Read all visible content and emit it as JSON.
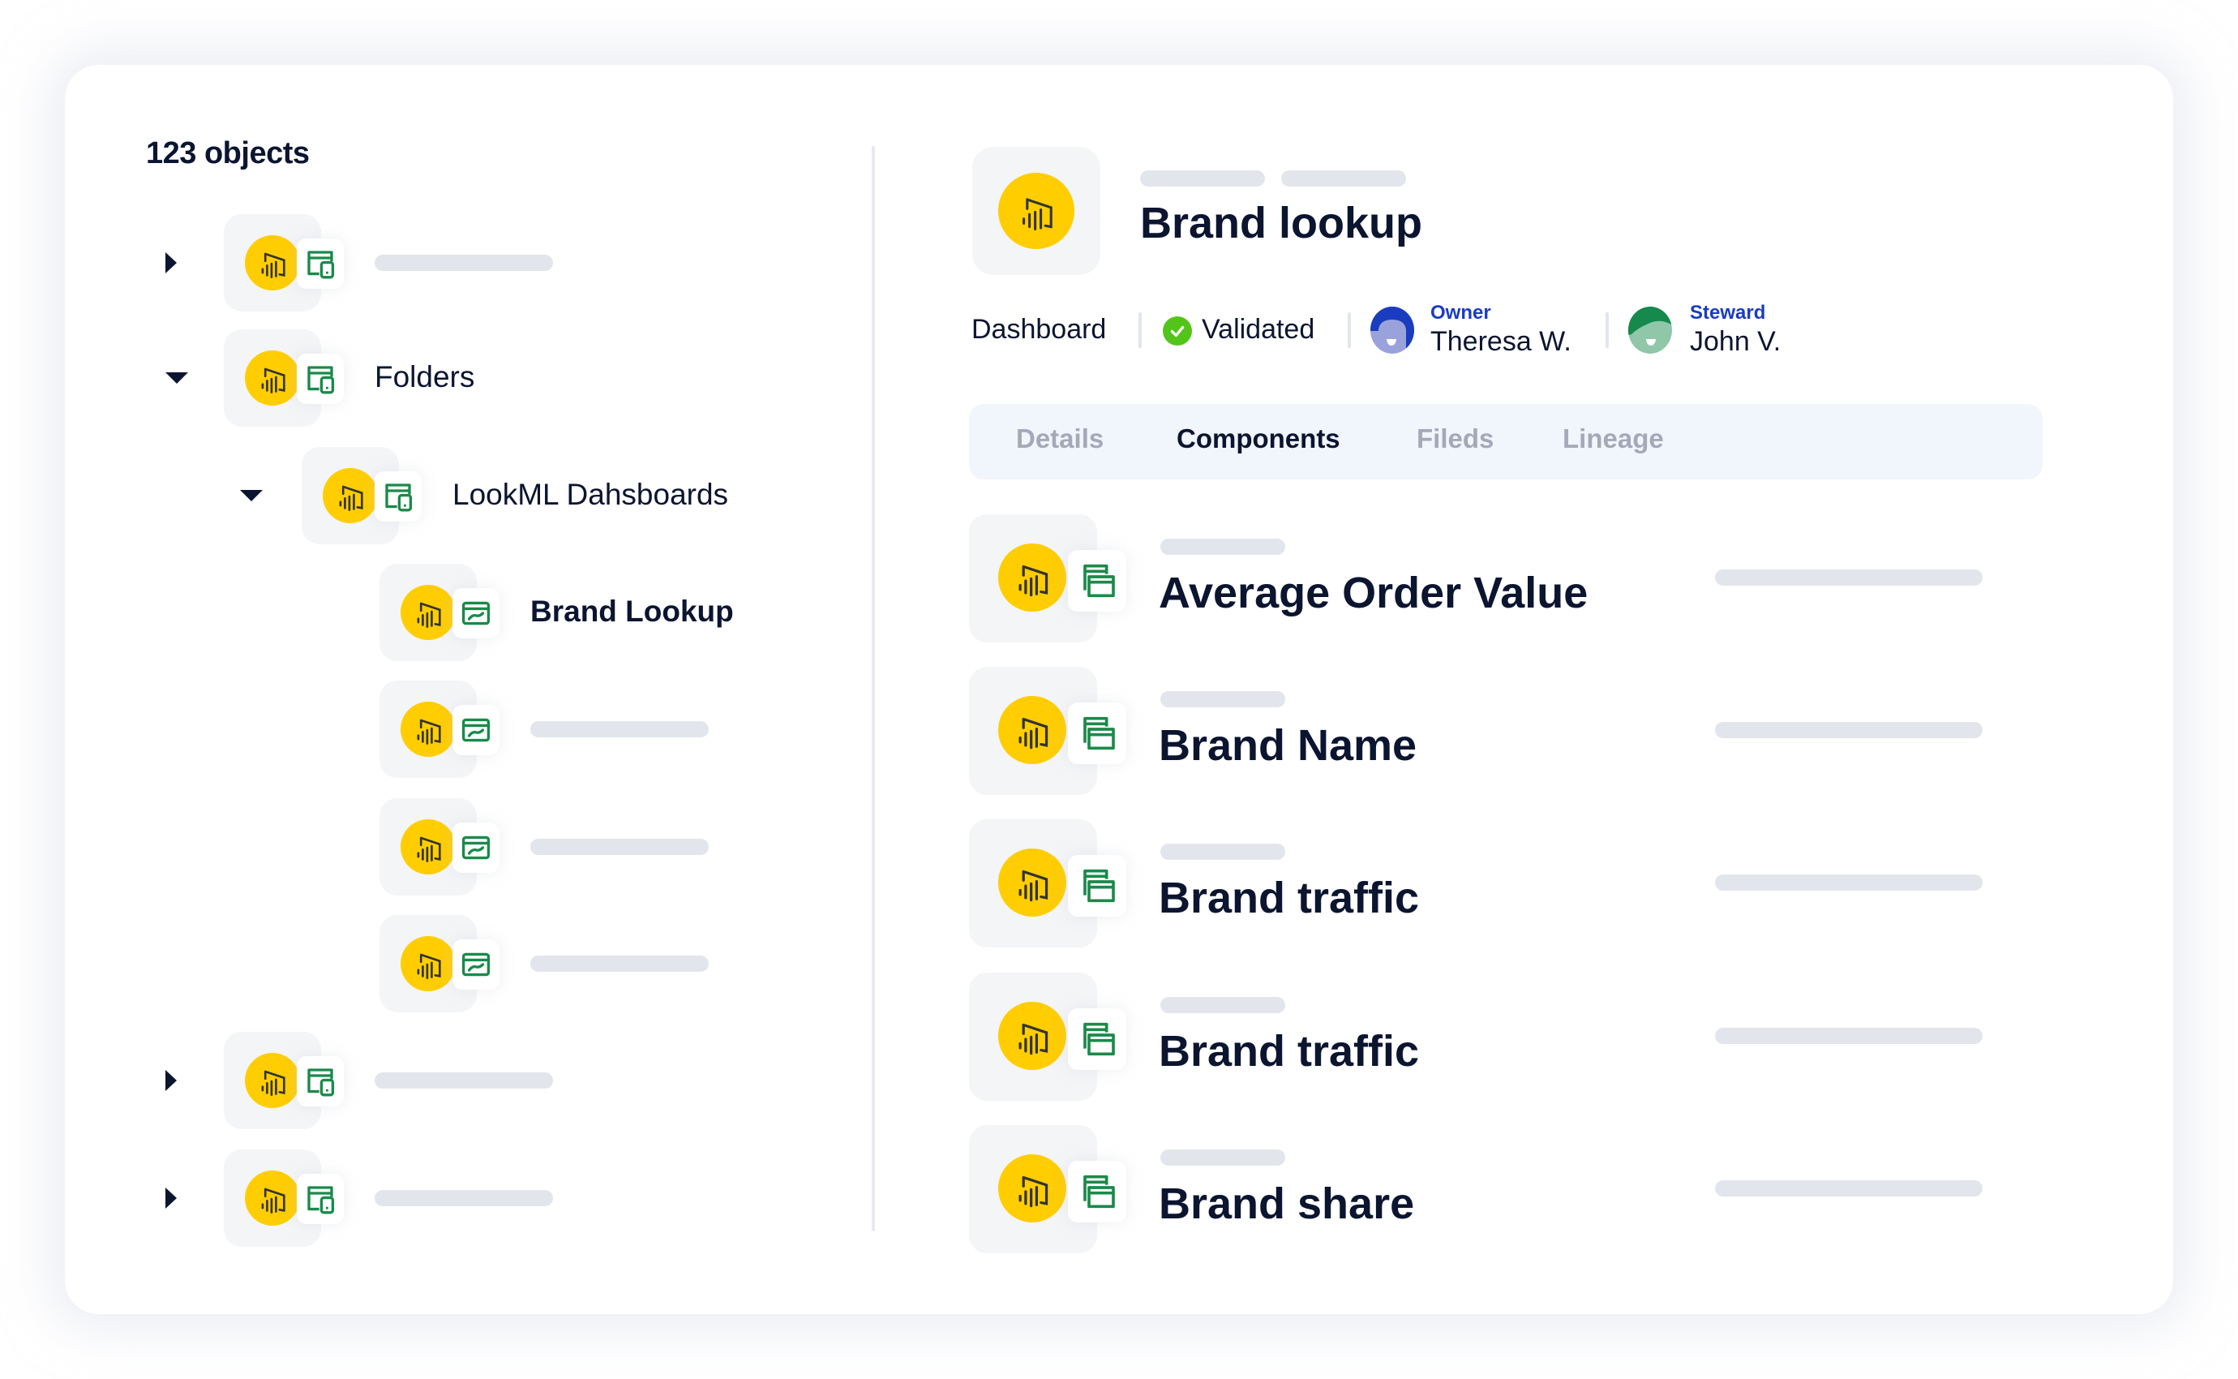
{
  "left_panel": {
    "count_title": "123 objects",
    "tree": [
      {
        "level": 0,
        "caret": "right",
        "label": null,
        "sub_icon": "dashboard-device-icon"
      },
      {
        "level": 0,
        "caret": "down",
        "label": "Folders",
        "sub_icon": "dashboard-device-icon"
      },
      {
        "level": 1,
        "caret": "down",
        "label": "LookML Dahsboards",
        "sub_icon": "dashboard-device-icon"
      },
      {
        "level": 2,
        "caret": null,
        "label": "Brand Lookup",
        "bold": true,
        "sub_icon": "chart-window-icon"
      },
      {
        "level": 2,
        "caret": null,
        "label": null,
        "sub_icon": "chart-window-icon"
      },
      {
        "level": 2,
        "caret": null,
        "label": null,
        "sub_icon": "chart-window-icon"
      },
      {
        "level": 2,
        "caret": null,
        "label": null,
        "sub_icon": "chart-window-icon"
      },
      {
        "level": 0,
        "caret": "right",
        "label": null,
        "sub_icon": "dashboard-device-icon"
      },
      {
        "level": 0,
        "caret": "right",
        "label": null,
        "sub_icon": "dashboard-device-icon"
      }
    ]
  },
  "detail": {
    "title": "Brand lookup",
    "type": "Dashboard",
    "status": "Validated",
    "owner": {
      "role": "Owner",
      "name": "Theresa W."
    },
    "steward": {
      "role": "Steward",
      "name": "John V."
    },
    "tabs": [
      {
        "label": "Details",
        "active": false
      },
      {
        "label": "Components",
        "active": true
      },
      {
        "label": "Fileds",
        "active": false
      },
      {
        "label": "Lineage",
        "active": false
      }
    ],
    "components": [
      {
        "name": "Average Order Value"
      },
      {
        "name": "Brand Name"
      },
      {
        "name": "Brand traffic"
      },
      {
        "name": "Brand traffic"
      },
      {
        "name": "Brand share"
      }
    ]
  },
  "colors": {
    "powerbi_yellow": "#ffcd00",
    "green_icon": "#1a8a4a",
    "text_dark": "#0b1530",
    "role_blue": "#1a3cbf",
    "validated_green": "#52c41a",
    "tab_inactive": "#a4a9b8",
    "placeholder": "#e2e5ec"
  }
}
